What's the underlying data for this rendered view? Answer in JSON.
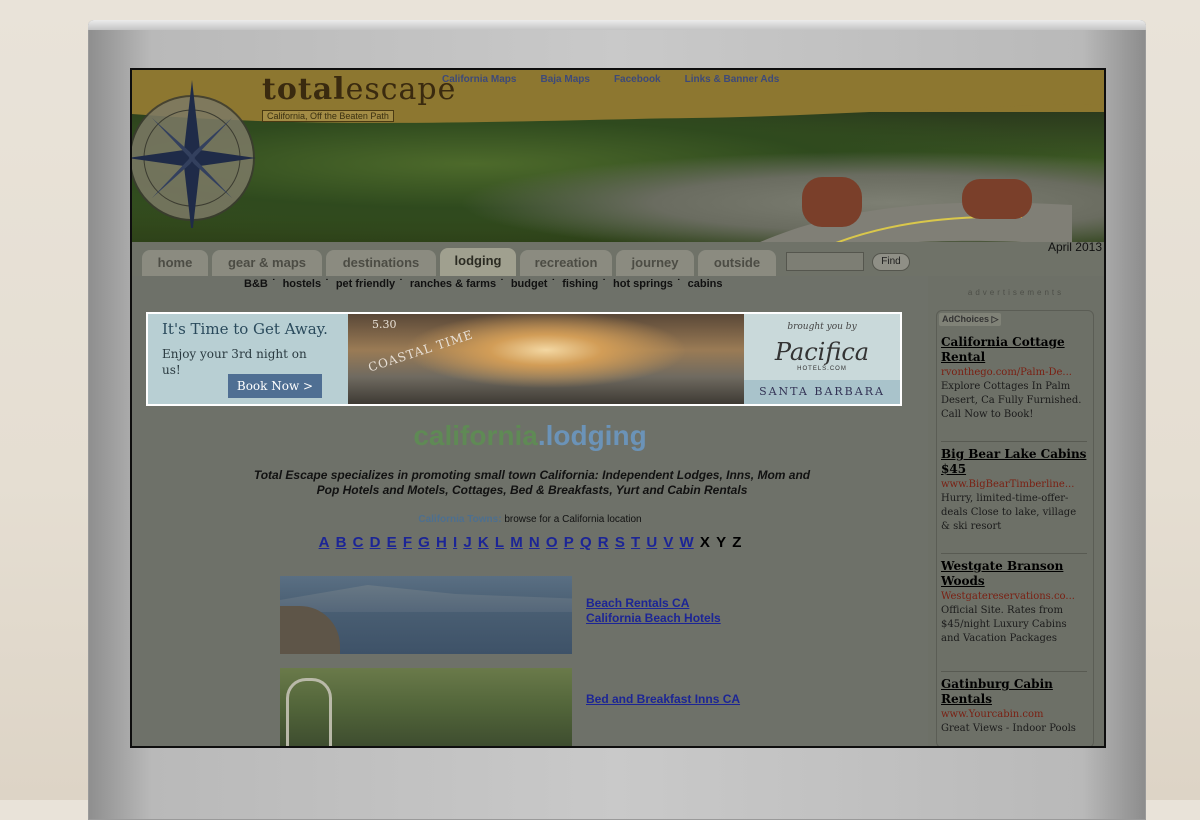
{
  "site": {
    "logo_word_small": "total",
    "logo_word_big": "escape",
    "tagline": "California, Off the Beaten Path",
    "top_links": [
      "California Maps",
      "Baja Maps",
      "Facebook",
      "Links & Banner Ads"
    ],
    "date": "April 2013"
  },
  "nav": {
    "tabs": [
      "home",
      "gear & maps",
      "destinations",
      "lodging",
      "recreation",
      "journey",
      "outside"
    ],
    "active": "lodging",
    "search_placeholder": "",
    "find_label": "Find",
    "subnav": [
      "B&B",
      "hostels",
      "pet friendly",
      "ranches & farms",
      "budget",
      "fishing",
      "hot springs",
      "cabins"
    ]
  },
  "banner": {
    "headline": "It's Time to Get Away.",
    "subline": "Enjoy your 3rd night on us!",
    "button": "Book Now >",
    "stamp_number": "5.30",
    "stamp_text": "COASTAL TIME",
    "brought": "brought you by",
    "brand": "Pacifica",
    "brand_sub": "HOTELS.COM",
    "location": "SANTA BARBARA"
  },
  "main": {
    "heading_a": "california",
    "heading_b": ".lodging",
    "intro": "Total Escape specializes in promoting small town California: Independent Lodges, Inns, Mom and Pop Hotels and Motels, Cottages, Bed & Breakfasts, Yurt and Cabin Rentals",
    "towns_label": "California Towns:",
    "towns_text": "browse for a California location",
    "alphabet_links": [
      "A",
      "B",
      "C",
      "D",
      "E",
      "F",
      "G",
      "H",
      "I",
      "J",
      "K",
      "L",
      "M",
      "N",
      "O",
      "P",
      "Q",
      "R",
      "S",
      "T",
      "U",
      "V",
      "W"
    ],
    "alphabet_plain": [
      "X",
      "Y",
      "Z"
    ],
    "entry1_links": [
      "Beach Rentals CA",
      "California Beach Hotels"
    ],
    "entry2_links": [
      "Bed and Breakfast Inns CA"
    ]
  },
  "sidebar": {
    "title": "advertisements",
    "adchoices": "AdChoices",
    "ads": [
      {
        "title": "California Cottage Rental",
        "url": "rvonthego.com/Palm-De...",
        "desc": "Explore Cottages In Palm Desert, Ca Fully Furnished. Call Now to Book!"
      },
      {
        "title": "Big Bear Lake Cabins $45",
        "url": "www.BigBearTimberline...",
        "desc": "Hurry, limited-time-offer-deals Close to lake, village & ski resort"
      },
      {
        "title": "Westgate Branson Woods",
        "url": "Westgatereservations.co...",
        "desc": "Official Site. Rates from $45/night Luxury Cabins and Vacation Packages"
      },
      {
        "title": "Gatinburg Cabin Rentals",
        "url": "www.Yourcabin.com",
        "desc": "Great Views - Indoor Pools"
      }
    ]
  }
}
